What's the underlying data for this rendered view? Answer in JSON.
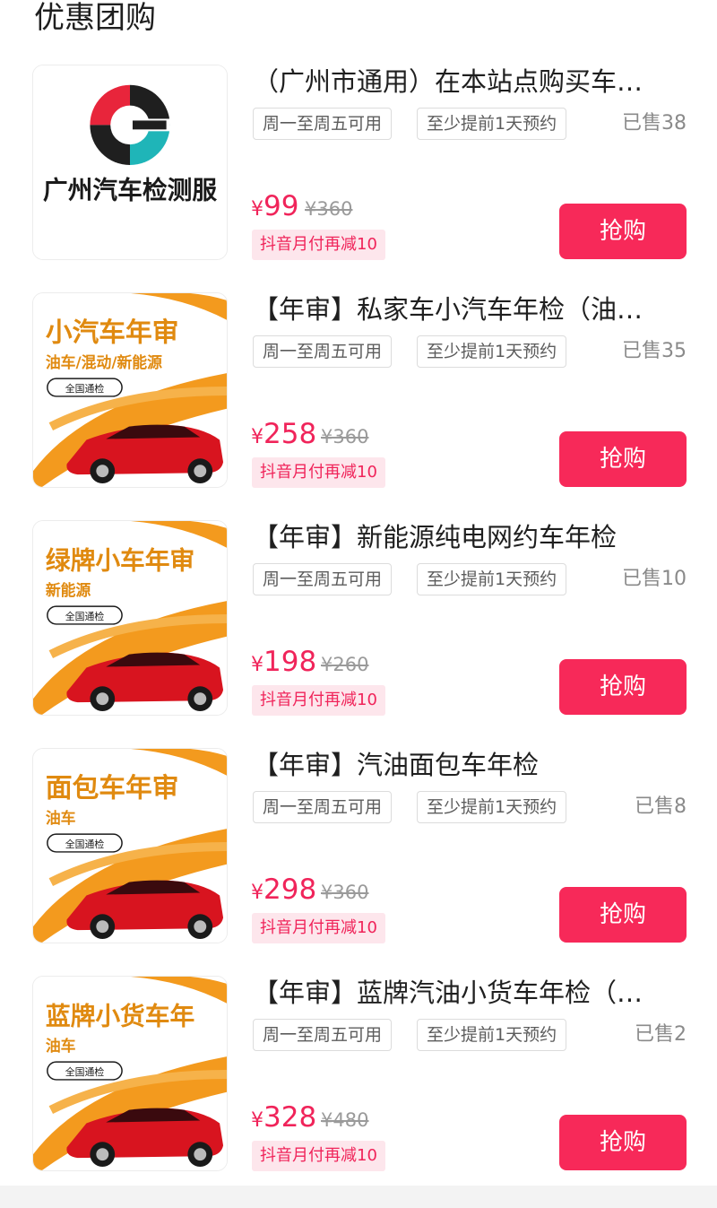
{
  "section_title": "优惠团购",
  "colors": {
    "accent": "#f72959",
    "price": "#f0245a",
    "promo_bg": "#fde6ec",
    "banner_orange": "#f39a1e",
    "car_red": "#d8141f"
  },
  "items": [
    {
      "title": "（广州市通用）在本站点购买车…",
      "tags": [
        "周一至周五可用",
        "至少提前1天预约"
      ],
      "sold": "已售38",
      "price_symbol": "¥",
      "price": "99",
      "original_price": "¥360",
      "promo": "抖音月付再减10",
      "buy_label": "抢购",
      "thumb": {
        "kind": "logo",
        "logo_letter": "G",
        "caption": "广州汽车检测服"
      }
    },
    {
      "title": "【年审】私家车小汽车年检（油…",
      "tags": [
        "周一至周五可用",
        "至少提前1天预约"
      ],
      "sold": "已售35",
      "price_symbol": "¥",
      "price": "258",
      "original_price": "¥360",
      "promo": "抖音月付再减10",
      "buy_label": "抢购",
      "thumb": {
        "kind": "car",
        "headline": "小汽车年审",
        "sub": "油车/混动/新能源",
        "badge": "全国通检"
      }
    },
    {
      "title": "【年审】新能源纯电网约车年检",
      "tags": [
        "周一至周五可用",
        "至少提前1天预约"
      ],
      "sold": "已售10",
      "price_symbol": "¥",
      "price": "198",
      "original_price": "¥260",
      "promo": "抖音月付再减10",
      "buy_label": "抢购",
      "thumb": {
        "kind": "car",
        "headline": "绿牌小车年审",
        "sub": "新能源",
        "badge": "全国通检"
      }
    },
    {
      "title": "【年审】汽油面包车年检",
      "tags": [
        "周一至周五可用",
        "至少提前1天预约"
      ],
      "sold": "已售8",
      "price_symbol": "¥",
      "price": "298",
      "original_price": "¥360",
      "promo": "抖音月付再减10",
      "buy_label": "抢购",
      "thumb": {
        "kind": "car",
        "headline": "面包车年审",
        "sub": "油车",
        "badge": "全国通检"
      }
    },
    {
      "title": "【年审】蓝牌汽油小货车年检（…",
      "tags": [
        "周一至周五可用",
        "至少提前1天预约"
      ],
      "sold": "已售2",
      "price_symbol": "¥",
      "price": "328",
      "original_price": "¥480",
      "promo": "抖音月付再减10",
      "buy_label": "抢购",
      "thumb": {
        "kind": "car",
        "headline": "蓝牌小货车年",
        "sub": "油车",
        "badge": "全国通检"
      }
    }
  ]
}
